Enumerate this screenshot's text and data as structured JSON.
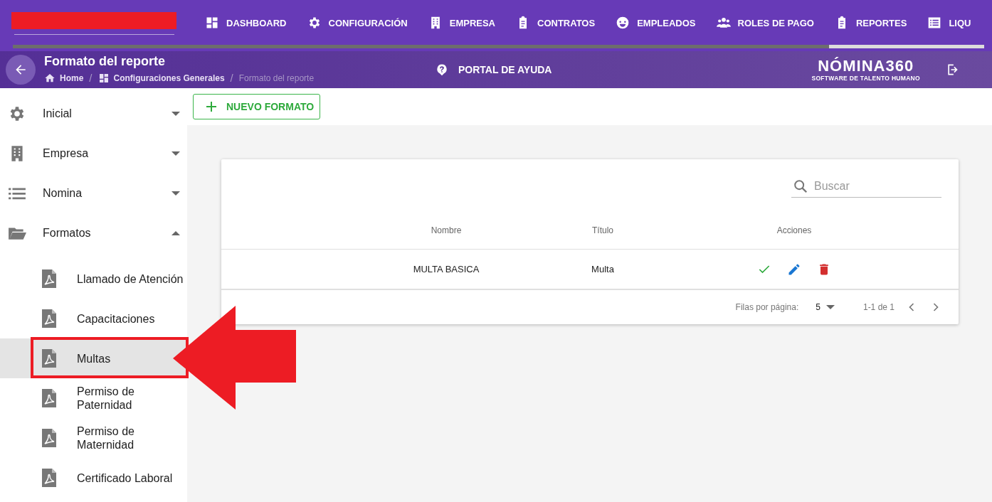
{
  "top_nav": {
    "items": [
      {
        "label": "DASHBOARD"
      },
      {
        "label": "CONFIGURACIÓN"
      },
      {
        "label": "EMPRESA"
      },
      {
        "label": "CONTRATOS"
      },
      {
        "label": "EMPLEADOS"
      },
      {
        "label": "ROLES DE PAGO"
      },
      {
        "label": "REPORTES"
      },
      {
        "label": "LIQU"
      }
    ]
  },
  "header": {
    "title": "Formato del reporte",
    "breadcrumb": [
      {
        "label": "Home",
        "current": false
      },
      {
        "label": "Configuraciones Generales",
        "current": false
      },
      {
        "label": "Formato del reporte",
        "current": true
      }
    ],
    "separator": "/",
    "help_link": "PORTAL DE AYUDA",
    "logo": {
      "name": "NÓMINA360",
      "tagline": "SOFTWARE DE TALENTO HUMANO"
    }
  },
  "sidebar": {
    "items": [
      {
        "label": "Inicial",
        "expanded": false
      },
      {
        "label": "Empresa",
        "expanded": false
      },
      {
        "label": "Nomina",
        "expanded": false
      },
      {
        "label": "Formatos",
        "expanded": true,
        "children": [
          {
            "label": "Llamado de Atención",
            "selected": false
          },
          {
            "label": "Capacitaciones",
            "selected": false
          },
          {
            "label": "Multas",
            "selected": true
          },
          {
            "label": "Permiso de Paternidad",
            "selected": false
          },
          {
            "label": "Permiso de Maternidad",
            "selected": false
          },
          {
            "label": "Certificado Laboral",
            "selected": false
          }
        ]
      }
    ]
  },
  "toolbar": {
    "new_button": "NUEVO FORMATO"
  },
  "table": {
    "search": {
      "placeholder": "Buscar"
    },
    "columns": [
      "Nombre",
      "Título",
      "Acciones"
    ],
    "rows": [
      {
        "nombre": "MULTA BASICA",
        "titulo": "Multa"
      }
    ],
    "pagination": {
      "rows_per_page_label": "Filas por página:",
      "rows_per_page": "5",
      "range": "1-1 de 1"
    }
  }
}
